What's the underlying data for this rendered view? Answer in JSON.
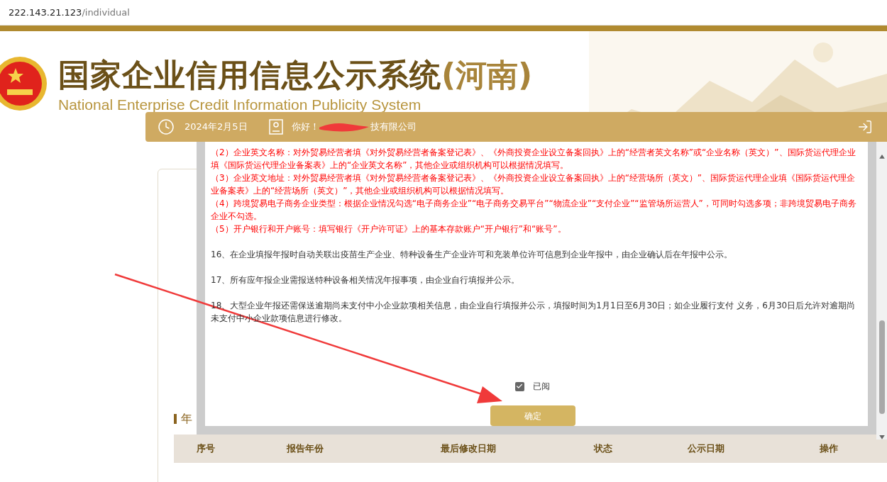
{
  "address_bar": {
    "host": "222.143.21.123",
    "path": "/individual"
  },
  "header": {
    "title": "国家企业信用信息公示系统",
    "region": "(河南)",
    "subtitle": "National Enterprise Credit Information Publicity System"
  },
  "user_bar": {
    "date": "2024年2月5日",
    "greeting": "你好！",
    "company_suffix": "技有限公司"
  },
  "notice": {
    "items": [
      {
        "color": "#ff0000",
        "text": "（2）企业英文名称：对外贸易经营者填《对外贸易经营者备案登记表》、《外商投资企业设立备案回执》上的“经营者英文名称”或“企业名称（英文）”、国际货运代理企业填《国际货运代理企业备案表》上的“企业英文名称”，其他企业或组织机构可以根据情况填写。"
      },
      {
        "color": "#ff0000",
        "text": "（3）企业英文地址：对外贸易经营者填《对外贸易经营者备案登记表》、《外商投资企业设立备案回执》上的“经营场所（英文）”、国际货运代理企业填《国际货运代理企业备案表》上的“经营场所（英文）”，其他企业或组织机构可以根据情况填写。"
      },
      {
        "color": "#ff0000",
        "text": "（4）跨境贸易电子商务企业类型：根据企业情况勾选“电子商务企业”“电子商务交易平台”“物流企业”“支付企业”“监管场所运营人”，可同时勾选多项；非跨境贸易电子商务企业不勾选。"
      },
      {
        "color": "#ff0000",
        "text": "（5）开户银行和开户账号：填写银行《开户许可证》上的基本存款账户“开户银行”和“账号”。"
      },
      {
        "color": "#333333",
        "text": "16、在企业填报年报时自动关联出疫苗生产企业、特种设备生产企业许可和充装单位许可信息到企业年报中，由企业确认后在年报中公示。"
      },
      {
        "color": "#333333",
        "text": "17、所有应年报企业需报送特种设备相关情况年报事项，由企业自行填报并公示。"
      },
      {
        "color": "#333333",
        "text": "18、大型企业年报还需保送逾期尚未支付中小企业款项相关信息，由企业自行填报并公示，填报时间为1月1日至6月30日；如企业履行支付 义务，6月30日后允许对逾期尚未支付中小企业款项信息进行修改。"
      }
    ]
  },
  "confirm": {
    "label": "已阅",
    "checked": true
  },
  "ok_button": "确定",
  "section_title": "年",
  "table": {
    "columns": [
      "序号",
      "报告年份",
      "最后修改日期",
      "状态",
      "公示日期",
      "操作"
    ]
  }
}
